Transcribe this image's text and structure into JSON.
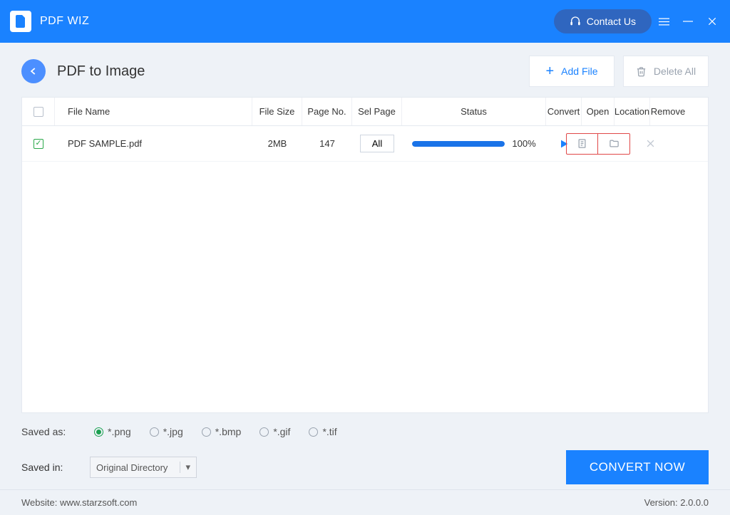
{
  "app": {
    "name": "PDF WIZ"
  },
  "titlebar": {
    "contact": "Contact Us"
  },
  "page": {
    "title": "PDF to Image"
  },
  "toolbar": {
    "add_file": "Add File",
    "delete_all": "Delete All"
  },
  "table": {
    "headers": {
      "file_name": "File Name",
      "file_size": "File Size",
      "page_no": "Page No.",
      "sel_page": "Sel Page",
      "status": "Status",
      "convert": "Convert",
      "open": "Open",
      "location": "Location",
      "remove": "Remove"
    },
    "rows": [
      {
        "checked": true,
        "name": "PDF SAMPLE.pdf",
        "size": "2MB",
        "pages": "147",
        "sel_page": "All",
        "progress_pct": 100,
        "progress_label": "100%"
      }
    ]
  },
  "options": {
    "saved_as_label": "Saved as:",
    "formats": {
      "png": "*.png",
      "jpg": "*.jpg",
      "bmp": "*.bmp",
      "gif": "*.gif",
      "tif": "*.tif"
    },
    "selected_format": "png",
    "saved_in_label": "Saved in:",
    "saved_in_value": "Original Directory"
  },
  "actions": {
    "convert_now": "CONVERT NOW"
  },
  "footer": {
    "website_label": "Website:",
    "website_value": "www.starzsoft.com",
    "version_label": "Version:",
    "version_value": "2.0.0.0"
  }
}
